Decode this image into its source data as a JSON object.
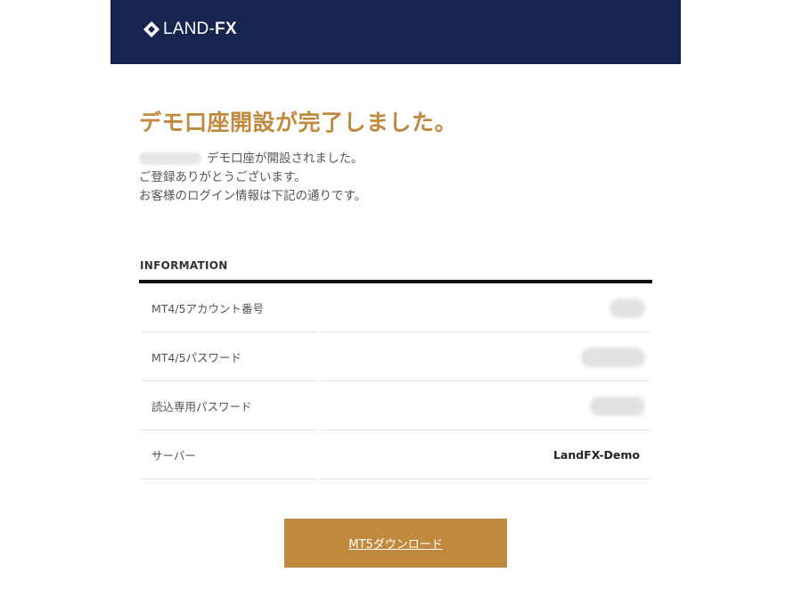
{
  "header": {
    "logo_text_land": "LAND-",
    "logo_text_fx": "FX",
    "background_color": "#17244f"
  },
  "main": {
    "title": "デモ口座開設が完了しました。",
    "message_line1": "デモ口座が開設されました。",
    "message_line2": "ご登録ありがとうございます。",
    "message_line3": "お客様のログイン情報は下記の通りです。"
  },
  "information": {
    "heading": "INFORMATION",
    "rows": [
      {
        "label": "MT4/5アカウント番号",
        "value": ""
      },
      {
        "label": "MT4/5パスワード",
        "value": ""
      },
      {
        "label": "読込専用パスワード",
        "value": ""
      },
      {
        "label": "サーバー",
        "value": "LandFX-Demo"
      }
    ]
  },
  "download": {
    "label": "MT5ダウンロード"
  },
  "colors": {
    "accent": "#c08a3e",
    "header_bg": "#17244f",
    "table_rule": "#111111"
  }
}
